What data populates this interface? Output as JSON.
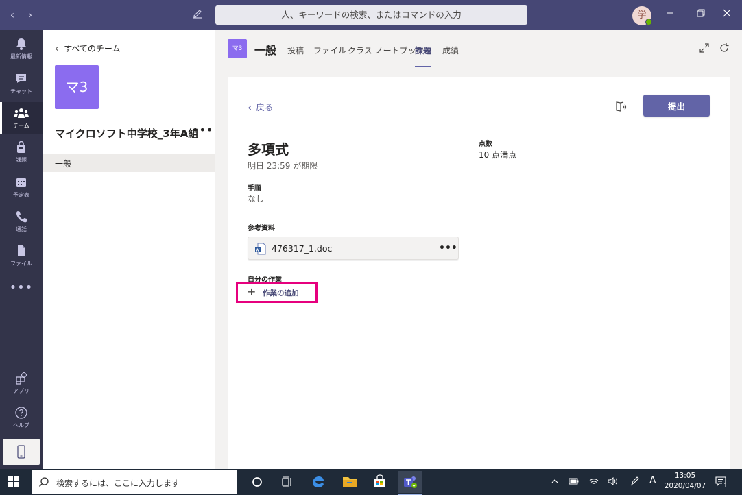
{
  "titlebar": {
    "search_placeholder": "人、キーワードの検索、またはコマンドの入力",
    "avatar_initial": "学"
  },
  "rail": {
    "items": [
      {
        "label": "最新情報",
        "icon": "bell-icon"
      },
      {
        "label": "チャット",
        "icon": "chat-icon"
      },
      {
        "label": "チーム",
        "icon": "teams-icon",
        "active": true
      },
      {
        "label": "課題",
        "icon": "assignments-icon"
      },
      {
        "label": "予定表",
        "icon": "calendar-icon"
      },
      {
        "label": "通話",
        "icon": "phone-icon"
      },
      {
        "label": "ファイル",
        "icon": "file-icon"
      }
    ],
    "more": "•••",
    "apps_label": "アプリ",
    "help_label": "ヘルプ"
  },
  "teampanel": {
    "all_teams": "すべてのチーム",
    "team_tile": "マ3",
    "team_name": "マイクロソフト中学校_3年A組",
    "more": "•••",
    "channel": "一般"
  },
  "channel": {
    "tile": "マ3",
    "name": "一般",
    "tabs": [
      "投稿",
      "ファイル",
      "クラス ノートブック",
      "課題",
      "成績"
    ],
    "active_tab": "課題"
  },
  "assignment": {
    "back": "戻る",
    "submit": "提出",
    "title": "多項式",
    "due": "明日 23:59 が期限",
    "points_label": "点数",
    "points_value": "10 点満点",
    "instructions_label": "手順",
    "instructions_value": "なし",
    "reference_label": "参考資料",
    "reference_file": "476317_1.doc",
    "file_more": "•••",
    "my_work_label": "自分の作業",
    "add_work": "作業の追加",
    "highlight_color": "#e6007e",
    "accent_color": "#6264a7"
  },
  "taskbar": {
    "search_placeholder": "検索するには、ここに入力します",
    "time": "13:05",
    "date": "2020/04/07",
    "ime": "A",
    "notifications": "1"
  }
}
